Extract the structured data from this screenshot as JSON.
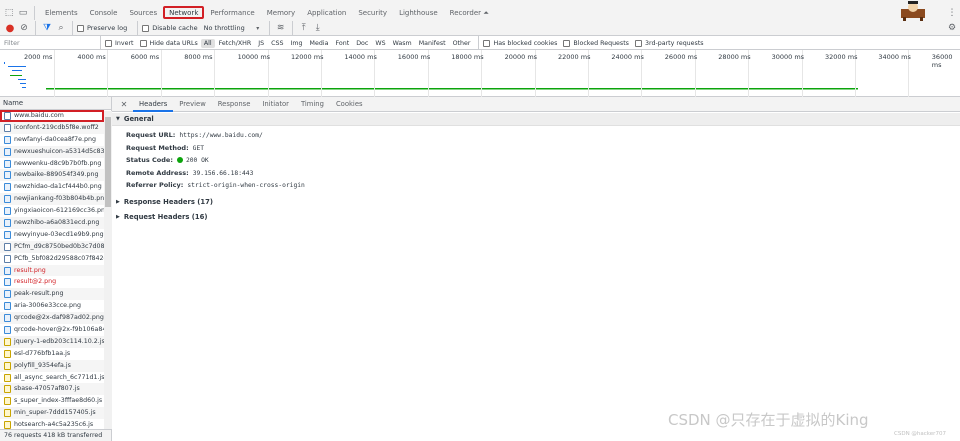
{
  "tabs": [
    "Elements",
    "Console",
    "Sources",
    "Network",
    "Performance",
    "Memory",
    "Application",
    "Security",
    "Lighthouse",
    "Recorder ⏶"
  ],
  "active_tab": "Network",
  "toolbar": {
    "preserve_log": "Preserve log",
    "disable_cache": "Disable cache",
    "throttling": "No throttling"
  },
  "filter": {
    "placeholder": "Filter",
    "invert": "Invert",
    "hide_data_urls": "Hide data URLs",
    "types": [
      "All",
      "Fetch/XHR",
      "JS",
      "CSS",
      "Img",
      "Media",
      "Font",
      "Doc",
      "WS",
      "Wasm",
      "Manifest",
      "Other"
    ],
    "selected_type": "All",
    "has_blocked_cookies": "Has blocked cookies",
    "blocked_requests": "Blocked Requests",
    "third_party": "3rd-party requests"
  },
  "timeline": {
    "ticks": [
      "2000 ms",
      "4000 ms",
      "6000 ms",
      "8000 ms",
      "10000 ms",
      "12000 ms",
      "14000 ms",
      "16000 ms",
      "18000 ms",
      "20000 ms",
      "22000 ms",
      "24000 ms",
      "26000 ms",
      "28000 ms",
      "30000 ms",
      "32000 ms",
      "34000 ms",
      "36000 ms"
    ]
  },
  "requests": {
    "header": "Name",
    "items": [
      {
        "name": "www.baidu.com",
        "type": "doc",
        "selected": true
      },
      {
        "name": "iconfont-219cdb5f8e.woff2",
        "type": "doc"
      },
      {
        "name": "newfanyi-da0cea8f7e.png",
        "type": "img"
      },
      {
        "name": "newxueshuicon-a5314d5c83...",
        "type": "img"
      },
      {
        "name": "newwenku-d8c9b7b0fb.png",
        "type": "img"
      },
      {
        "name": "newbaike-889054f349.png",
        "type": "img"
      },
      {
        "name": "newzhidao-da1cf444b0.png",
        "type": "img"
      },
      {
        "name": "newjiankang-f03b804b4b.png",
        "type": "img"
      },
      {
        "name": "yingxiaoicon-612169cc36.png",
        "type": "img"
      },
      {
        "name": "newzhibo-a6a0831ecd.png",
        "type": "img"
      },
      {
        "name": "newyinyue-03ecd1e9b9.png",
        "type": "img"
      },
      {
        "name": "PCfm_d9c8750bed0b3c7d089",
        "type": "doc"
      },
      {
        "name": "PCfb_5bf082d29588c07f842cc",
        "type": "doc"
      },
      {
        "name": "result.png",
        "type": "img",
        "red": true
      },
      {
        "name": "result@2.png",
        "type": "img",
        "red": true
      },
      {
        "name": "peak-result.png",
        "type": "img"
      },
      {
        "name": "aria-3006e33cce.png",
        "type": "img"
      },
      {
        "name": "qrcode@2x-daf987ad02.png",
        "type": "img"
      },
      {
        "name": "qrcode-hover@2x-f9b106a84",
        "type": "img"
      },
      {
        "name": "jquery-1-edb203c114.10.2.js",
        "type": "js"
      },
      {
        "name": "esl-d776bfb1aa.js",
        "type": "js"
      },
      {
        "name": "polyfill_9354efa.js",
        "type": "js"
      },
      {
        "name": "all_async_search_6c771d1.js",
        "type": "js"
      },
      {
        "name": "sbase-47057af807.js",
        "type": "js"
      },
      {
        "name": "s_super_index-3fffae8d60.js",
        "type": "js"
      },
      {
        "name": "min_super-7ddd157405.js",
        "type": "js"
      },
      {
        "name": "hotsearch-a4c5a235c6.js",
        "type": "js"
      }
    ]
  },
  "status_bar": "76 requests  418 kB transferred",
  "detail_tabs": [
    "Headers",
    "Preview",
    "Response",
    "Initiator",
    "Timing",
    "Cookies"
  ],
  "active_detail_tab": "Headers",
  "general": {
    "title": "General",
    "fields": [
      {
        "key": "Request URL:",
        "value": "https://www.baidu.com/"
      },
      {
        "key": "Request Method:",
        "value": "GET"
      },
      {
        "key": "Status Code:",
        "value": "200 OK"
      },
      {
        "key": "Remote Address:",
        "value": "39.156.66.18:443"
      },
      {
        "key": "Referrer Policy:",
        "value": "strict-origin-when-cross-origin"
      }
    ]
  },
  "response_headers": "Response Headers (17)",
  "request_headers": "Request Headers (16)",
  "watermark": "CSDN @只存在于虚拟的King",
  "watermark_small": "CSDN @hacker707",
  "colors": {
    "accent": "#1a73e8",
    "highlight": "#d21f25",
    "status_ok": "#0ca40c",
    "timeline_bar": "#0ca40c"
  }
}
